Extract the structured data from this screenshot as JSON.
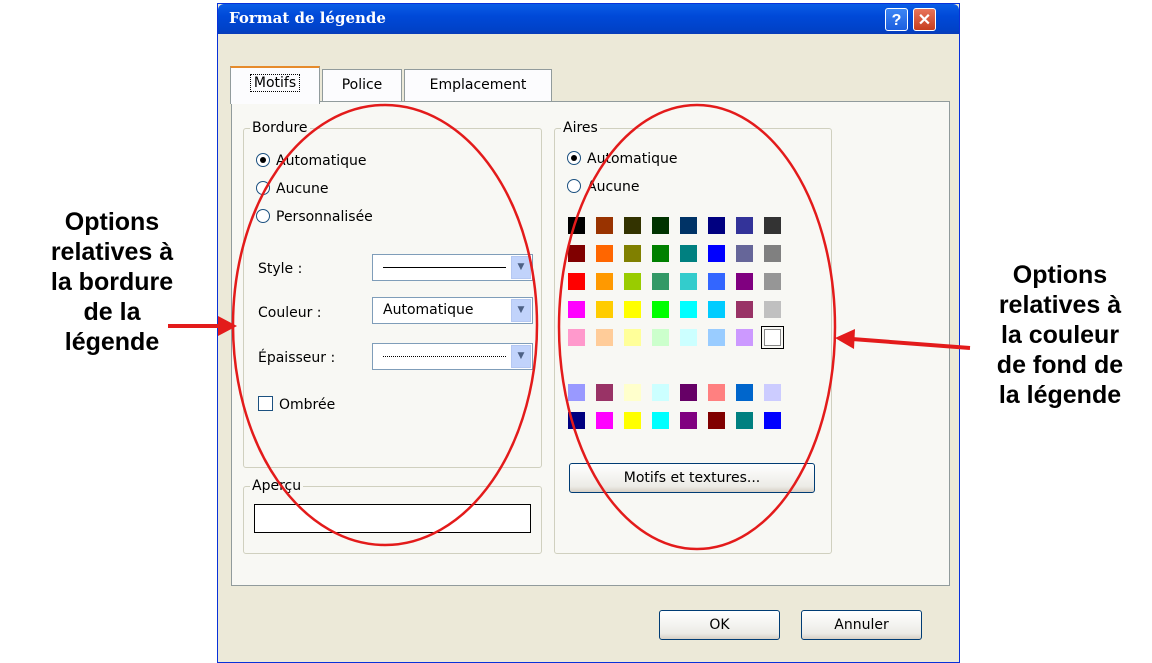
{
  "callouts": {
    "left": [
      "Options",
      "relatives à",
      "la bordure",
      "de la",
      "légende"
    ],
    "right": [
      "Options",
      "relatives à",
      "la couleur",
      "de fond de",
      "la légende"
    ]
  },
  "dialog": {
    "title": "Format de légende",
    "help_glyph": "?",
    "close_glyph": "✕",
    "tabs": [
      {
        "label": "Motifs",
        "active": true
      },
      {
        "label": "Police",
        "active": false
      },
      {
        "label": "Emplacement",
        "active": false
      }
    ],
    "border_group": {
      "label": "Bordure",
      "options": [
        {
          "label": "Automatique",
          "checked": true
        },
        {
          "label": "Aucune",
          "checked": false
        },
        {
          "label": "Personnalisée",
          "checked": false
        }
      ],
      "style_label": "Style :",
      "color_label": "Couleur :",
      "color_value": "Automatique",
      "weight_label": "Épaisseur :",
      "shadow_label": "Ombrée",
      "shadow_checked": false
    },
    "area_group": {
      "label": "Aires",
      "options": [
        {
          "label": "Automatique",
          "checked": true
        },
        {
          "label": "Aucune",
          "checked": false
        }
      ],
      "palette": [
        [
          "#000000",
          "#993300",
          "#333300",
          "#003300",
          "#003366",
          "#000080",
          "#333399",
          "#333333"
        ],
        [
          "#800000",
          "#ff6600",
          "#808000",
          "#008000",
          "#008080",
          "#0000ff",
          "#666699",
          "#808080"
        ],
        [
          "#ff0000",
          "#ff9900",
          "#99cc00",
          "#339966",
          "#33cccc",
          "#3366ff",
          "#800080",
          "#969696"
        ],
        [
          "#ff00ff",
          "#ffcc00",
          "#ffff00",
          "#00ff00",
          "#00ffff",
          "#00ccff",
          "#993366",
          "#c0c0c0"
        ],
        [
          "#ff99cc",
          "#ffcc99",
          "#ffff99",
          "#ccffcc",
          "#ccffff",
          "#99ccff",
          "#cc99ff",
          "#ffffff"
        ]
      ],
      "palette_extra": [
        [
          "#9999ff",
          "#993366",
          "#ffffcc",
          "#ccffff",
          "#660066",
          "#ff8080",
          "#0066cc",
          "#ccccff"
        ],
        [
          "#000080",
          "#ff00ff",
          "#ffff00",
          "#00ffff",
          "#800080",
          "#800000",
          "#008080",
          "#0000ff"
        ]
      ],
      "selected_color": "#ffffff",
      "patterns_button": "Motifs et textures..."
    },
    "preview_group": {
      "label": "Aperçu"
    },
    "ok_label": "OK",
    "cancel_label": "Annuler"
  },
  "annotation_color": "#e31b1b"
}
